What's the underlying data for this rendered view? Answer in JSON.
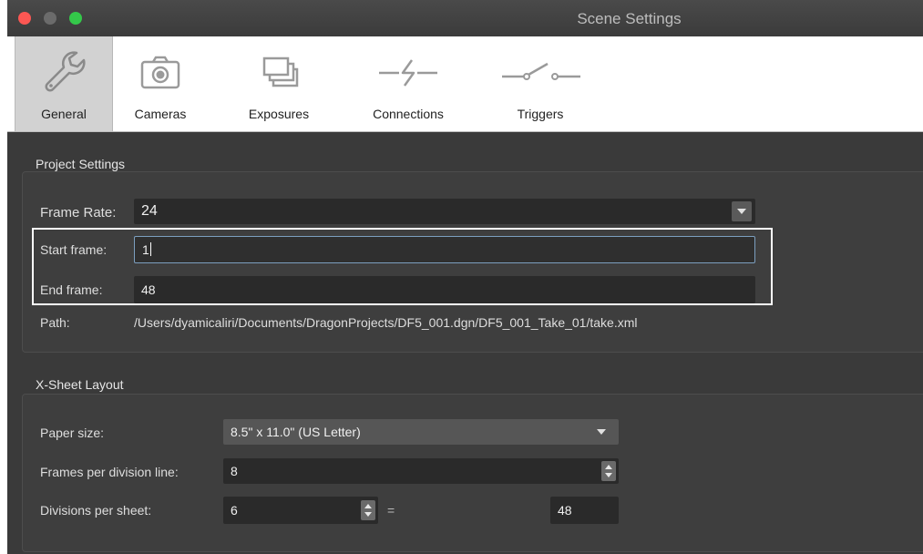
{
  "window": {
    "title": "Scene Settings"
  },
  "toolbar": {
    "tabs": [
      {
        "label": "General",
        "icon": "wrench-icon",
        "active": true
      },
      {
        "label": "Cameras",
        "icon": "camera-icon",
        "active": false
      },
      {
        "label": "Exposures",
        "icon": "exposures-icon",
        "active": false
      },
      {
        "label": "Connections",
        "icon": "connections-icon",
        "active": false
      },
      {
        "label": "Triggers",
        "icon": "triggers-icon",
        "active": false
      }
    ]
  },
  "project_settings": {
    "title": "Project Settings",
    "frame_rate_label": "Frame Rate:",
    "frame_rate_value": "24",
    "start_frame_label": "Start frame:",
    "start_frame_value": "1",
    "end_frame_label": "End frame:",
    "end_frame_value": "48",
    "path_label": "Path:",
    "path_value": "/Users/dyamicaliri/Documents/DragonProjects/DF5_001.dgn/DF5_001_Take_01/take.xml"
  },
  "xsheet_layout": {
    "title": "X-Sheet Layout",
    "paper_size_label": "Paper size:",
    "paper_size_value": "8.5\" x 11.0\" (US Letter)",
    "frames_per_division_label": "Frames per division line:",
    "frames_per_division_value": "8",
    "divisions_per_sheet_label": "Divisions per sheet:",
    "divisions_per_sheet_value": "6",
    "equals": "=",
    "total_frames_value": "48"
  },
  "colors": {
    "panel_bg": "#3a3a3a",
    "field_bg": "#2a2a2a",
    "focus_border": "#7c9fbf",
    "close": "#fc5753",
    "zoom": "#34c84a"
  }
}
